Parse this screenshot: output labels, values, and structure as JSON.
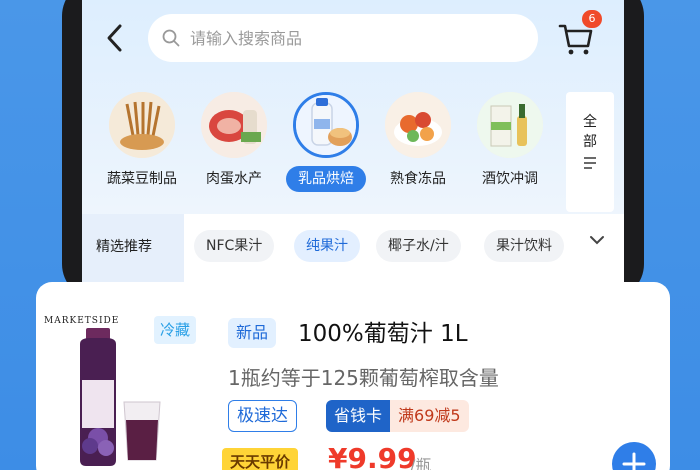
{
  "header": {
    "back_icon": "chevron-left-icon",
    "search_placeholder": "请输入搜索商品",
    "cart_icon": "shopping-cart-icon",
    "cart_count": "6"
  },
  "categories": [
    {
      "label": "蔬菜豆制品",
      "icon": "vegetables-icon",
      "active": false
    },
    {
      "label": "肉蛋水产",
      "icon": "meat-icon",
      "active": false
    },
    {
      "label": "乳品烘焙",
      "icon": "dairy-icon",
      "active": true
    },
    {
      "label": "熟食冻品",
      "icon": "cooked-food-icon",
      "active": false
    },
    {
      "label": "酒饮冲调",
      "icon": "drinks-icon",
      "active": false
    }
  ],
  "all_button": {
    "line1": "全",
    "line2": "部",
    "icon": "list-icon"
  },
  "filter": {
    "title": "精选推荐",
    "chips": [
      {
        "label": "NFC果汁",
        "active": false
      },
      {
        "label": "纯果汁",
        "active": true
      },
      {
        "label": "椰子水/汁",
        "active": false
      },
      {
        "label": "果汁饮料",
        "active": false
      }
    ],
    "expand_icon": "chevron-down-icon"
  },
  "product": {
    "brand": "MARKETSIDE",
    "cold_tag": "冷藏",
    "new_tag": "新品",
    "title": "100%葡萄汁 1L",
    "subtitle": "1瓶约等于125颗葡萄榨取含量",
    "fast_tag": "极速达",
    "card_tag_left": "省钱卡",
    "card_tag_right": "满69减5",
    "price_badge": "天天平价",
    "price": "¥9.99",
    "unit": "/瓶",
    "add_icon": "plus-icon"
  },
  "colors": {
    "accent": "#2f7ee8",
    "price": "#ef3a2a",
    "badge_yellow": "#ffd437",
    "background": "#4a97e8"
  }
}
